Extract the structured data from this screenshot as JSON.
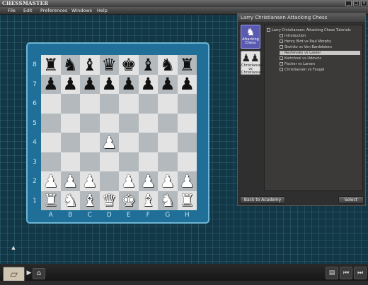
{
  "app": {
    "logo": "CHESSMASTER"
  },
  "menu": [
    "File",
    "Edit",
    "Preferences",
    "Windows",
    "Help"
  ],
  "board": {
    "ranks": [
      "8",
      "7",
      "6",
      "5",
      "4",
      "3",
      "2",
      "1"
    ],
    "files": [
      "A",
      "B",
      "C",
      "D",
      "E",
      "F",
      "G",
      "H"
    ],
    "position": [
      [
        "r",
        "n",
        "b",
        "q",
        "k",
        "b",
        "n",
        "r"
      ],
      [
        "p",
        "p",
        "p",
        "p",
        "p",
        "p",
        "p",
        "p"
      ],
      [
        "",
        "",
        "",
        "",
        "",
        "",
        "",
        ""
      ],
      [
        "",
        "",
        "",
        "",
        "",
        "",
        "",
        ""
      ],
      [
        "",
        "",
        "",
        "P",
        "",
        "",
        "",
        ""
      ],
      [
        "",
        "",
        "",
        "",
        "",
        "",
        "",
        ""
      ],
      [
        "P",
        "P",
        "P",
        "",
        "P",
        "P",
        "P",
        "P"
      ],
      [
        "R",
        "N",
        "B",
        "Q",
        "K",
        "B",
        "N",
        "R"
      ]
    ]
  },
  "panel": {
    "title": "Larry Christiansen Attacking Chess",
    "courses": [
      {
        "label": "Attacking Chess",
        "icon": "attack-book-icon",
        "active": true
      },
      {
        "label": "Christiansen vs Christiansen",
        "icon": "pawns-icon",
        "active": false
      }
    ],
    "tree": [
      {
        "label": "Larry Christiansen: Attacking Chess Tutorials",
        "level": 0,
        "selected": false
      },
      {
        "label": "Introduction",
        "level": 1,
        "selected": false
      },
      {
        "label": "Henry Bird vs Paul Morphy",
        "level": 1,
        "selected": false
      },
      {
        "label": "Steinitz vs Von Bardeleben",
        "level": 1,
        "selected": false
      },
      {
        "label": "Reshevsky vs Lasker",
        "level": 1,
        "selected": true
      },
      {
        "label": "Kortchnoi vs Udovcic",
        "level": 1,
        "selected": false
      },
      {
        "label": "Fischer vs Larsen",
        "level": 1,
        "selected": false
      },
      {
        "label": "Christiansen vs Fougel",
        "level": 1,
        "selected": false
      }
    ],
    "back_label": "Back to Academy",
    "select_label": "Select"
  }
}
